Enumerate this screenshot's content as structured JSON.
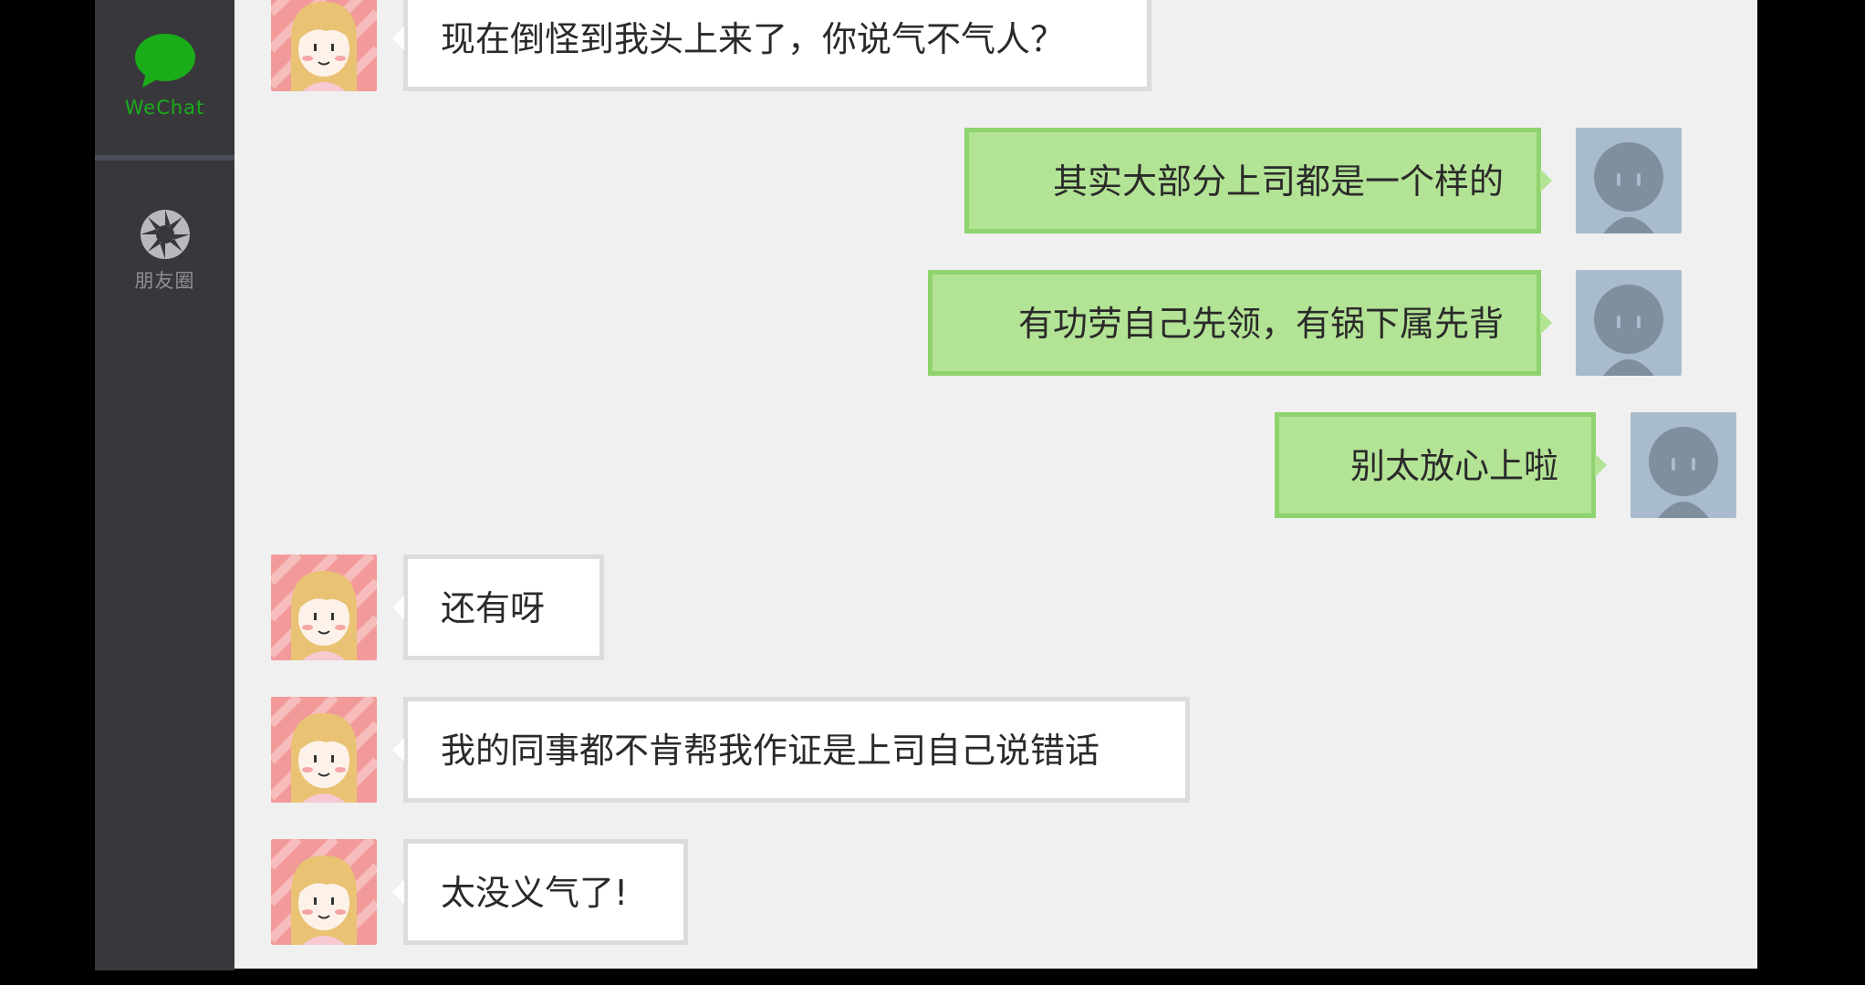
{
  "app": {
    "name": "WeChat"
  },
  "sidebar": {
    "items": [
      {
        "label": "WeChat",
        "icon": "chat-bubble-icon",
        "active": true,
        "color": "#1aad19"
      },
      {
        "label": "朋友圈",
        "icon": "moments-shutter-icon",
        "active": false,
        "color": "#8e8e92"
      }
    ]
  },
  "colors": {
    "sidebar_bg": "#38383c",
    "chat_bg": "#f0f0f0",
    "incoming_bubble": "#ffffff",
    "outgoing_bubble": "#b3e395",
    "accent": "#1aad19"
  },
  "messages": [
    {
      "direction": "incoming",
      "text": "现在倒怪到我头上来了，你说气不气人？"
    },
    {
      "direction": "outgoing",
      "text": "其实大部分上司都是一个样的"
    },
    {
      "direction": "outgoing",
      "text": "有功劳自己先领，有锅下属先背"
    },
    {
      "direction": "outgoing",
      "text": "别太放心上啦"
    },
    {
      "direction": "incoming",
      "text": "还有呀"
    },
    {
      "direction": "incoming",
      "text": "我的同事都不肯帮我作证是上司自己说错话"
    },
    {
      "direction": "incoming",
      "text": "太没义气了!"
    }
  ]
}
